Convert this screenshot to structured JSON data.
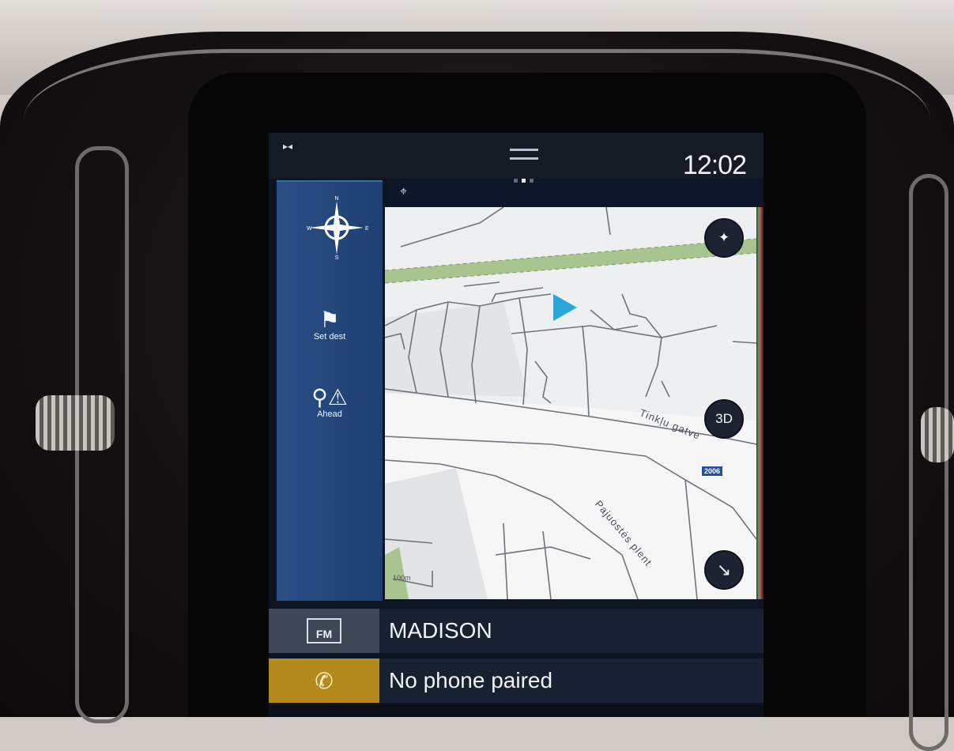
{
  "status": {
    "time": "12:02"
  },
  "sidebar": {
    "compass": {
      "n": "N",
      "s": "S",
      "e": "E",
      "w": "W"
    },
    "set_dest": "Set dest",
    "ahead": "Ahead"
  },
  "map": {
    "street_1": "Tinkļu gatve",
    "street_2": "Pajuostės plent",
    "road_number": "2006",
    "scale": "100m",
    "btn_3d": "3D"
  },
  "media": {
    "icon_label": "FM",
    "station": "MADISON"
  },
  "phone": {
    "status": "No phone paired"
  },
  "colors": {
    "sidebar": "#1e3f72",
    "phone_accent": "#b58a1c",
    "position_arrow": "#2aa7d6",
    "park_green": "#a8c48f"
  }
}
